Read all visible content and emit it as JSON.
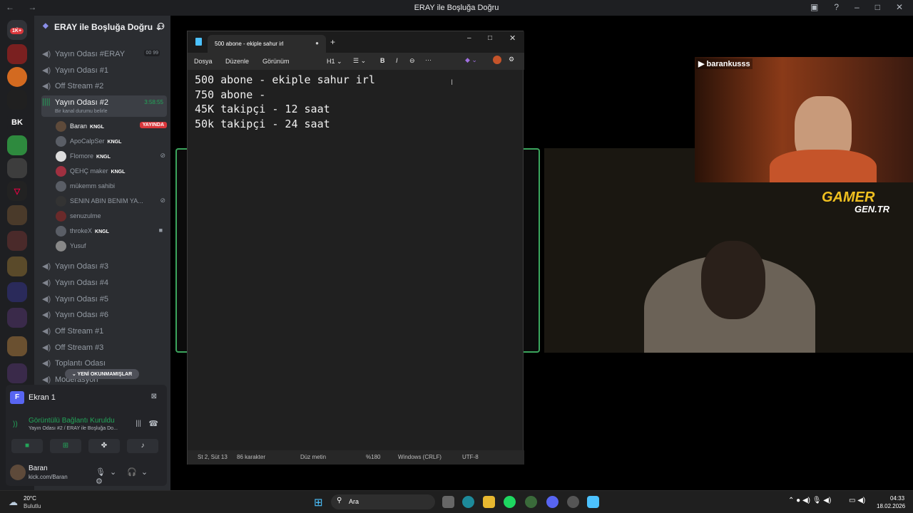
{
  "window": {
    "title": "ERAY ile Boşluğa Doğru",
    "nav": "← →"
  },
  "servers": {
    "notification": "1K+",
    "labels": [
      "BK"
    ]
  },
  "sidebar": {
    "guild": "ERAY ile Boşluğa Doğru",
    "channels_top": [
      {
        "name": "Yayın Odası #ERAY",
        "counts": [
          "00",
          "99"
        ]
      },
      {
        "name": "Yayın Odası #1"
      },
      {
        "name": "Off Stream #2"
      }
    ],
    "active": {
      "name": "Yayın Odası #2",
      "time": "3:58:55",
      "status": "Bir kanal durumu belirle"
    },
    "members": [
      {
        "name": "Baran",
        "tag": "KNGL",
        "live": "YAYINDA"
      },
      {
        "name": "ApoCalpSer",
        "tag": "KNGL"
      },
      {
        "name": "Flomore",
        "tag": "KNGL"
      },
      {
        "name": "QEHÇ maker",
        "tag": "KNGL"
      },
      {
        "name": "mükemm sahibi",
        "tag": ""
      },
      {
        "name": "SENIN ABIN BENIM YA...",
        "tag": ""
      },
      {
        "name": "senuzulme",
        "tag": ""
      },
      {
        "name": "throkeX",
        "tag": "KNGL"
      },
      {
        "name": "Yusuf",
        "tag": ""
      }
    ],
    "channels_bottom": [
      "Yayın Odası #3",
      "Yayın Odası #4",
      "Yayın Odası #5",
      "Yayın Odası #6",
      "Off Stream #1",
      "Off Stream #3",
      "Toplantı Odası",
      "Moderasyon"
    ],
    "new_messages": "YENİ OKUNMAMIŞLAR"
  },
  "voice": {
    "screen": "Ekran 1",
    "connected": "Görüntülü Bağlantı Kuruldu",
    "channel": "Yayın Odası #2 / ERAY ile Boşluğa Do...",
    "user": "Baran",
    "user_status": "kick.com/Baran"
  },
  "notepad": {
    "tab": "500 abone - ekiple sahur irl",
    "menu": [
      "Dosya",
      "Düzenle",
      "Görünüm"
    ],
    "heading": "H1",
    "lines": [
      "500 abone - ekiple sahur irl",
      "750 abone -",
      "45K takipçi - 12 saat",
      "50k takipçi - 24 saat"
    ],
    "status": {
      "pos": "St 2, Süt 13",
      "chars": "86 karakter",
      "mode": "Düz metin",
      "zoom": "%180",
      "eol": "Windows (CRLF)",
      "enc": "UTF-8"
    }
  },
  "stream": {
    "channel": "barankusss",
    "watermark": "GAMER",
    "watermark2": "GEN.TR"
  },
  "taskbar": {
    "weather_temp": "20°C",
    "weather_desc": "Bulutlu",
    "search": "Ara",
    "time": "04:33",
    "date": "18.02.2026"
  }
}
